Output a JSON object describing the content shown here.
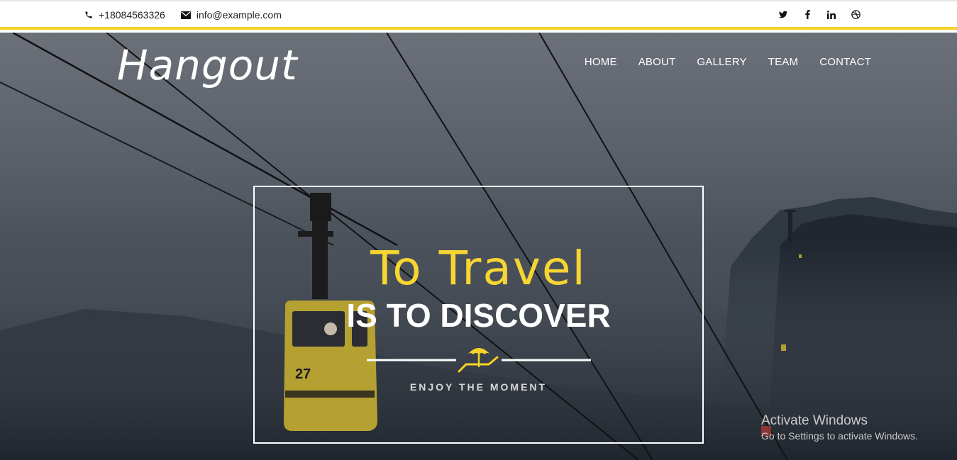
{
  "topbar": {
    "phone": "+18084563326",
    "email": "info@example.com",
    "social": [
      {
        "icon": "twitter-icon",
        "glyph": "t"
      },
      {
        "icon": "facebook-icon",
        "glyph": "f"
      },
      {
        "icon": "linkedin-icon",
        "glyph": "in"
      },
      {
        "icon": "dribbble-icon",
        "glyph": "◎"
      }
    ]
  },
  "brand": "Hangout",
  "nav": [
    "HOME",
    "ABOUT",
    "GALLERY",
    "TEAM",
    "CONTACT"
  ],
  "hero": {
    "title_line1": "To Travel",
    "title_line2": "IS TO DISCOVER",
    "tagline": "ENJOY THE MOMENT",
    "gondola_number": "27"
  },
  "watermark": {
    "line1": "Activate Windows",
    "line2": "Go to Settings to activate Windows."
  },
  "colors": {
    "accent": "#f5d327",
    "accent_text": "#f7d532"
  }
}
